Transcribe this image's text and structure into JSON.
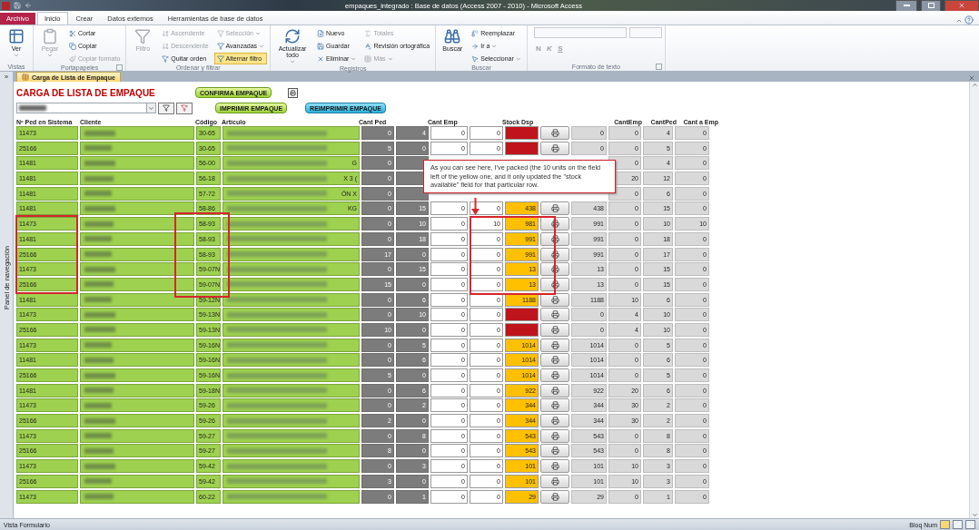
{
  "window": {
    "title": "empaques_integrado : Base de datos (Access 2007 - 2010)  -  Microsoft Access"
  },
  "ribbon_tabs": [
    {
      "label": "Archivo",
      "kind": "file",
      "selected": false
    },
    {
      "label": "Inicio",
      "kind": "tab",
      "selected": true
    },
    {
      "label": "Crear",
      "kind": "tab",
      "selected": false
    },
    {
      "label": "Datos externos",
      "kind": "tab",
      "selected": false
    },
    {
      "label": "Herramientas de base de datos",
      "kind": "tab",
      "selected": false
    }
  ],
  "ribbon_groups": [
    {
      "label": "Vistas",
      "launcher": false,
      "items": [
        {
          "label": "Ver",
          "kind": "large",
          "dropdown": true,
          "disabled": false,
          "selected": false
        }
      ]
    },
    {
      "label": "Portapapeles",
      "launcher": true,
      "items": [
        {
          "label": "Pegar",
          "kind": "large",
          "dropdown": true,
          "disabled": true,
          "selected": false
        },
        {
          "label": "Cortar",
          "kind": "small",
          "dropdown": false,
          "disabled": false,
          "selected": false
        },
        {
          "label": "Copiar",
          "kind": "small",
          "dropdown": false,
          "disabled": false,
          "selected": false
        },
        {
          "label": "Copiar formato",
          "kind": "small",
          "dropdown": false,
          "disabled": true,
          "selected": false
        }
      ]
    },
    {
      "label": "Ordenar y filtrar",
      "launcher": false,
      "items": [
        {
          "label": "Filtro",
          "kind": "large",
          "dropdown": false,
          "disabled": true,
          "selected": false
        },
        {
          "label": "Ascendente",
          "kind": "small",
          "dropdown": false,
          "disabled": true,
          "selected": false
        },
        {
          "label": "Descendente",
          "kind": "small",
          "dropdown": false,
          "disabled": true,
          "selected": false
        },
        {
          "label": "Quitar orden",
          "kind": "small",
          "dropdown": false,
          "disabled": false,
          "selected": false
        },
        {
          "label": "Selección",
          "kind": "small",
          "dropdown": true,
          "disabled": true,
          "selected": false
        },
        {
          "label": "Avanzadas",
          "kind": "small",
          "dropdown": true,
          "disabled": false,
          "selected": false
        },
        {
          "label": "Alternar filtro",
          "kind": "small",
          "dropdown": false,
          "disabled": false,
          "selected": true
        }
      ]
    },
    {
      "label": "Registros",
      "launcher": false,
      "items": [
        {
          "label": "Actualizar todo",
          "kind": "large",
          "dropdown": true,
          "disabled": false,
          "selected": false
        },
        {
          "label": "Nuevo",
          "kind": "small",
          "dropdown": false,
          "disabled": false,
          "selected": false
        },
        {
          "label": "Guardar",
          "kind": "small",
          "dropdown": false,
          "disabled": false,
          "selected": false
        },
        {
          "label": "Eliminar",
          "kind": "small",
          "dropdown": true,
          "disabled": false,
          "selected": false
        },
        {
          "label": "Totales",
          "kind": "small",
          "dropdown": false,
          "disabled": true,
          "selected": false
        },
        {
          "label": "Revisión ortográfica",
          "kind": "small",
          "dropdown": false,
          "disabled": false,
          "selected": false
        },
        {
          "label": "Más",
          "kind": "small",
          "dropdown": true,
          "disabled": true,
          "selected": false
        }
      ]
    },
    {
      "label": "Buscar",
      "launcher": false,
      "items": [
        {
          "label": "Buscar",
          "kind": "large",
          "dropdown": false,
          "disabled": false,
          "selected": false
        },
        {
          "label": "Reemplazar",
          "kind": "small",
          "dropdown": false,
          "disabled": false,
          "selected": false
        },
        {
          "label": "Ir a",
          "kind": "small",
          "dropdown": true,
          "disabled": false,
          "selected": false
        },
        {
          "label": "Seleccionar",
          "kind": "small",
          "dropdown": true,
          "disabled": false,
          "selected": false
        }
      ]
    },
    {
      "label": "Formato de texto",
      "launcher": true,
      "items": [
        {
          "label": "N",
          "kind": "glyph",
          "dropdown": false,
          "disabled": true,
          "selected": false
        },
        {
          "label": "K",
          "kind": "glyph",
          "dropdown": false,
          "disabled": true,
          "selected": false
        },
        {
          "label": "S",
          "kind": "glyph",
          "dropdown": false,
          "disabled": true,
          "selected": false
        }
      ]
    }
  ],
  "nav_toggle": "»",
  "document_tab": {
    "label": "Carga de Lista de Empaque",
    "selected": true
  },
  "navigation_pane": {
    "label": "Panel de navegación"
  },
  "form": {
    "title": "CARGA DE LISTA DE EMPAQUE",
    "buttons": [
      {
        "label": "CONFIRMA EMPAQUE",
        "kind": "green"
      },
      {
        "label": "IMPRIMIR EMPAQUE",
        "kind": "green"
      },
      {
        "label": "REIMPRIMIR EMPAQUE",
        "kind": "blue"
      }
    ],
    "columns": {
      "ped": "Nº Ped en Sistema",
      "client": "Cliente",
      "code": "Código",
      "article": "Artículo",
      "cant_ped": "Cant Ped",
      "cant_emp": "Cant Emp",
      "stock": "Stock Dsp",
      "cant_emp_2": "CantEmp",
      "cant_ped_2": "CantPed",
      "cant_a_emp": "Cant a Emp"
    },
    "rows": [
      {
        "ped": "11473",
        "code": "30-65",
        "col_a": "0",
        "col_b": "4",
        "emp_a": "0",
        "emp_b": "0",
        "stock": {
          "color": "#c0141c"
        },
        "col_c": "0",
        "cant_emp": "0",
        "cant_ped": "4",
        "cant_a_emp": "0"
      },
      {
        "ped": "25166",
        "code": "30-65",
        "col_a": "5",
        "col_b": "0",
        "emp_a": "0",
        "emp_b": "0",
        "stock": {
          "color": "#c0141c"
        },
        "col_c": "0",
        "cant_emp": "0",
        "cant_ped": "5",
        "cant_a_emp": "0"
      },
      {
        "ped": "11481",
        "code": "56-00",
        "suffix": "G",
        "col_a": "0",
        "cant_emp": "0",
        "cant_ped": "4",
        "cant_a_emp": "0"
      },
      {
        "ped": "11481",
        "code": "56-18",
        "suffix": "X 3 (",
        "col_a": "0",
        "cant_emp": "20",
        "cant_ped": "12",
        "cant_a_emp": "0"
      },
      {
        "ped": "11481",
        "code": "57-72",
        "suffix": "ÓN X",
        "col_a": "0",
        "cant_emp": "0",
        "cant_ped": "6",
        "cant_a_emp": "0"
      },
      {
        "ped": "11481",
        "code": "58-86",
        "suffix": "KG",
        "col_a": "0",
        "col_b": "15",
        "emp_a": "0",
        "emp_b": "0",
        "stock": {
          "value": "438",
          "color": "#ffc000"
        },
        "col_c": "438",
        "cant_emp": "0",
        "cant_ped": "15",
        "cant_a_emp": "0"
      },
      {
        "ped": "11473",
        "code": "58-93",
        "col_a": "0",
        "col_b": "10",
        "emp_a": "0",
        "emp_b": "10",
        "stock": {
          "value": "981",
          "color": "#ffc000"
        },
        "col_c": "991",
        "cant_emp": "0",
        "cant_ped": "10",
        "cant_a_emp": "10"
      },
      {
        "ped": "11481",
        "code": "58-93",
        "col_a": "0",
        "col_b": "18",
        "emp_a": "0",
        "emp_b": "0",
        "stock": {
          "value": "991",
          "color": "#ffc000"
        },
        "col_c": "991",
        "cant_emp": "0",
        "cant_ped": "18",
        "cant_a_emp": "0"
      },
      {
        "ped": "25166",
        "code": "58-93",
        "col_a": "17",
        "col_b": "0",
        "emp_a": "0",
        "emp_b": "0",
        "stock": {
          "value": "991",
          "color": "#ffc000"
        },
        "col_c": "991",
        "cant_emp": "0",
        "cant_ped": "17",
        "cant_a_emp": "0"
      },
      {
        "ped": "11473",
        "code": "59-07N",
        "col_a": "0",
        "col_b": "15",
        "emp_a": "0",
        "emp_b": "0",
        "stock": {
          "value": "13",
          "color": "#ffc000"
        },
        "col_c": "13",
        "cant_emp": "0",
        "cant_ped": "15",
        "cant_a_emp": "0"
      },
      {
        "ped": "25166",
        "code": "59-07N",
        "col_a": "15",
        "col_b": "0",
        "emp_a": "0",
        "emp_b": "0",
        "stock": {
          "value": "13",
          "color": "#ffc000"
        },
        "col_c": "13",
        "cant_emp": "0",
        "cant_ped": "15",
        "cant_a_emp": "0"
      },
      {
        "ped": "11481",
        "code": "59-12N",
        "col_a": "0",
        "col_b": "6",
        "emp_a": "0",
        "emp_b": "0",
        "stock": {
          "value": "1188",
          "color": "#ffc000"
        },
        "col_c": "1188",
        "cant_emp": "10",
        "cant_ped": "6",
        "cant_a_emp": "0"
      },
      {
        "ped": "11473",
        "code": "59-13N",
        "col_a": "0",
        "col_b": "10",
        "emp_a": "0",
        "emp_b": "0",
        "stock": {
          "color": "#c0141c"
        },
        "col_c": "0",
        "cant_emp": "4",
        "cant_ped": "10",
        "cant_a_emp": "0"
      },
      {
        "ped": "25166",
        "code": "59-13N",
        "col_a": "10",
        "col_b": "0",
        "emp_a": "0",
        "emp_b": "0",
        "stock": {
          "color": "#c0141c"
        },
        "col_c": "0",
        "cant_emp": "4",
        "cant_ped": "10",
        "cant_a_emp": "0"
      },
      {
        "ped": "11473",
        "code": "59-16N",
        "col_a": "0",
        "col_b": "5",
        "emp_a": "0",
        "emp_b": "0",
        "stock": {
          "value": "1014",
          "color": "#ffc000"
        },
        "col_c": "1014",
        "cant_emp": "0",
        "cant_ped": "5",
        "cant_a_emp": "0"
      },
      {
        "ped": "11481",
        "code": "59-16N",
        "col_a": "0",
        "col_b": "6",
        "emp_a": "0",
        "emp_b": "0",
        "stock": {
          "value": "1014",
          "color": "#ffc000"
        },
        "col_c": "1014",
        "cant_emp": "0",
        "cant_ped": "6",
        "cant_a_emp": "0"
      },
      {
        "ped": "25166",
        "code": "59-16N",
        "col_a": "5",
        "col_b": "0",
        "emp_a": "0",
        "emp_b": "0",
        "stock": {
          "value": "1014",
          "color": "#ffc000"
        },
        "col_c": "1014",
        "cant_emp": "0",
        "cant_ped": "5",
        "cant_a_emp": "0"
      },
      {
        "ped": "11481",
        "code": "59-18N",
        "col_a": "0",
        "col_b": "6",
        "emp_a": "0",
        "emp_b": "0",
        "stock": {
          "value": "922",
          "color": "#ffc000"
        },
        "col_c": "922",
        "cant_emp": "20",
        "cant_ped": "6",
        "cant_a_emp": "0"
      },
      {
        "ped": "11473",
        "code": "59-26",
        "col_a": "0",
        "col_b": "2",
        "emp_a": "0",
        "emp_b": "0",
        "stock": {
          "value": "344",
          "color": "#ffc000"
        },
        "col_c": "344",
        "cant_emp": "30",
        "cant_ped": "2",
        "cant_a_emp": "0"
      },
      {
        "ped": "25166",
        "code": "59-26",
        "col_a": "2",
        "col_b": "0",
        "emp_a": "0",
        "emp_b": "0",
        "stock": {
          "value": "344",
          "color": "#ffc000"
        },
        "col_c": "344",
        "cant_emp": "30",
        "cant_ped": "2",
        "cant_a_emp": "0"
      },
      {
        "ped": "11473",
        "code": "59-27",
        "col_a": "0",
        "col_b": "8",
        "emp_a": "0",
        "emp_b": "0",
        "stock": {
          "value": "543",
          "color": "#ffc000"
        },
        "col_c": "543",
        "cant_emp": "0",
        "cant_ped": "8",
        "cant_a_emp": "0"
      },
      {
        "ped": "25166",
        "code": "59-27",
        "col_a": "8",
        "col_b": "0",
        "emp_a": "0",
        "emp_b": "0",
        "stock": {
          "value": "543",
          "color": "#ffc000"
        },
        "col_c": "543",
        "cant_emp": "0",
        "cant_ped": "8",
        "cant_a_emp": "0"
      },
      {
        "ped": "11473",
        "code": "59-42",
        "col_a": "0",
        "col_b": "3",
        "emp_a": "0",
        "emp_b": "0",
        "stock": {
          "value": "101",
          "color": "#ffc000"
        },
        "col_c": "101",
        "cant_emp": "10",
        "cant_ped": "3",
        "cant_a_emp": "0"
      },
      {
        "ped": "25166",
        "code": "59-42",
        "col_a": "3",
        "col_b": "0",
        "emp_a": "0",
        "emp_b": "0",
        "stock": {
          "value": "101",
          "color": "#ffc000"
        },
        "col_c": "101",
        "cant_emp": "10",
        "cant_ped": "3",
        "cant_a_emp": "0"
      },
      {
        "ped": "11473",
        "code": "60-22",
        "col_a": "0",
        "col_b": "1",
        "emp_a": "0",
        "emp_b": "0",
        "stock": {
          "value": "29",
          "color": "#ffc000"
        },
        "col_c": "29",
        "cant_emp": "0",
        "cant_ped": "1",
        "cant_a_emp": "0"
      }
    ]
  },
  "callout": {
    "text": "As you can see here, I've packed (the 10 units on the field left of the yellow one, and it only updated the \"stock available\" field for that particular row."
  },
  "status_bar": {
    "left": "Vista Formulario",
    "right": "Bloq Num"
  }
}
